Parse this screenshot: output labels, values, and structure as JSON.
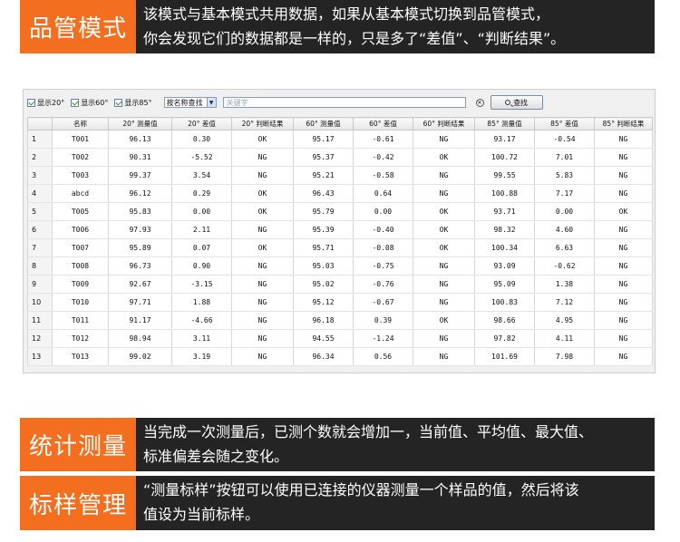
{
  "banners": [
    {
      "tag": "品管模式",
      "lines": [
        "该模式与基本模式共用数据，如果从基本模式切换到品管模式，",
        "你会发现它们的数据都是一样的，只是多了“差值”、“判断结果”。"
      ]
    },
    {
      "tag": "统计测量",
      "lines": [
        "当完成一次测量后，已测个数就会增加一，当前值、平均值、最大值、",
        "标准偏差会随之变化。"
      ]
    },
    {
      "tag": "标样管理",
      "lines": [
        "“测量标样”按钮可以使用已连接的仪器测量一个样品的值，然后将该",
        "值设为当前标样。"
      ]
    }
  ],
  "toolbar": {
    "show20": "显示20°",
    "show60": "显示60°",
    "show85": "显示85°",
    "search_mode": "按名称查找",
    "keyword_placeholder": "关键字",
    "search_label": "查找"
  },
  "table": {
    "headers": [
      "",
      "名称",
      "20° 测量值",
      "20° 差值",
      "20° 判断结果",
      "60° 测量值",
      "60° 差值",
      "60° 判断结果",
      "85° 测量值",
      "85° 差值",
      "85° 判断结果"
    ],
    "rows": [
      [
        "1",
        "T001",
        "96.13",
        "0.30",
        "OK",
        "95.17",
        "-0.61",
        "NG",
        "93.17",
        "-0.54",
        "NG"
      ],
      [
        "2",
        "T002",
        "90.31",
        "-5.52",
        "NG",
        "95.37",
        "-0.42",
        "OK",
        "100.72",
        "7.01",
        "NG"
      ],
      [
        "3",
        "T003",
        "99.37",
        "3.54",
        "NG",
        "95.21",
        "-0.58",
        "NG",
        "99.55",
        "5.83",
        "NG"
      ],
      [
        "4",
        "abcd",
        "96.12",
        "0.29",
        "OK",
        "96.43",
        "0.64",
        "NG",
        "100.88",
        "7.17",
        "NG"
      ],
      [
        "5",
        "T005",
        "95.83",
        "0.00",
        "OK",
        "95.79",
        "0.00",
        "OK",
        "93.71",
        "0.00",
        "OK"
      ],
      [
        "6",
        "T006",
        "97.93",
        "2.11",
        "NG",
        "95.39",
        "-0.40",
        "OK",
        "98.32",
        "4.60",
        "NG"
      ],
      [
        "7",
        "T007",
        "95.89",
        "0.07",
        "OK",
        "95.71",
        "-0.08",
        "OK",
        "100.34",
        "6.63",
        "NG"
      ],
      [
        "8",
        "T008",
        "96.73",
        "0.90",
        "NG",
        "95.03",
        "-0.75",
        "NG",
        "93.09",
        "-0.62",
        "NG"
      ],
      [
        "9",
        "T009",
        "92.67",
        "-3.15",
        "NG",
        "95.02",
        "-0.76",
        "NG",
        "95.09",
        "1.38",
        "NG"
      ],
      [
        "10",
        "T010",
        "97.71",
        "1.88",
        "NG",
        "95.12",
        "-0.67",
        "NG",
        "100.83",
        "7.12",
        "NG"
      ],
      [
        "11",
        "T011",
        "91.17",
        "-4.66",
        "NG",
        "96.18",
        "0.39",
        "OK",
        "98.66",
        "4.95",
        "NG"
      ],
      [
        "12",
        "T012",
        "98.94",
        "3.11",
        "NG",
        "94.55",
        "-1.24",
        "NG",
        "97.82",
        "4.11",
        "NG"
      ],
      [
        "13",
        "T013",
        "99.02",
        "3.19",
        "NG",
        "96.34",
        "0.56",
        "NG",
        "101.69",
        "7.98",
        "NG"
      ]
    ]
  },
  "colors": {
    "accent": "#f36f1f",
    "dark": "#242424"
  }
}
